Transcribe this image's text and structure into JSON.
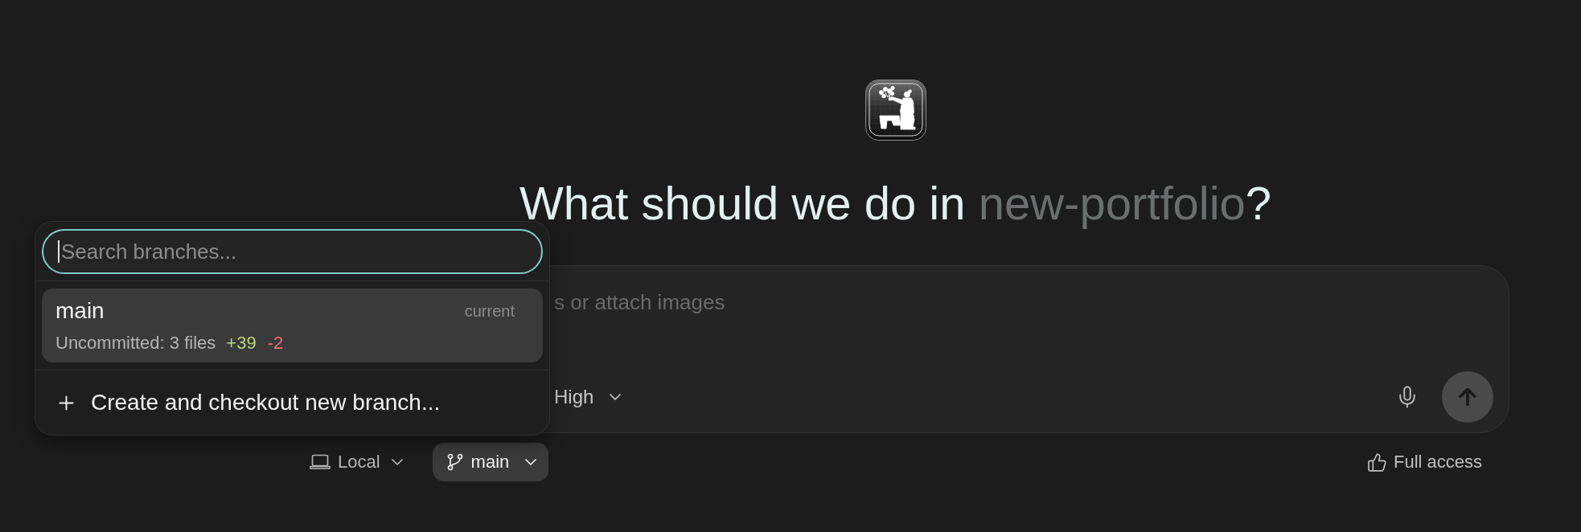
{
  "heading": {
    "prefix": "What should we do in",
    "project": "new-portfolio",
    "suffix": "?"
  },
  "branch_menu": {
    "search": {
      "placeholder": "Search branches...",
      "focused": true
    },
    "branches": [
      {
        "name": "main",
        "tag": "current",
        "status": "Uncommitted: 3 files",
        "additions": "+39",
        "deletions": "-2",
        "selected": true
      }
    ],
    "create_label": "Create and checkout new branch..."
  },
  "composer": {
    "placeholder": "s or attach images",
    "effort": "High"
  },
  "footer": {
    "environment": "Local",
    "branch": "main",
    "access": "Full access"
  }
}
